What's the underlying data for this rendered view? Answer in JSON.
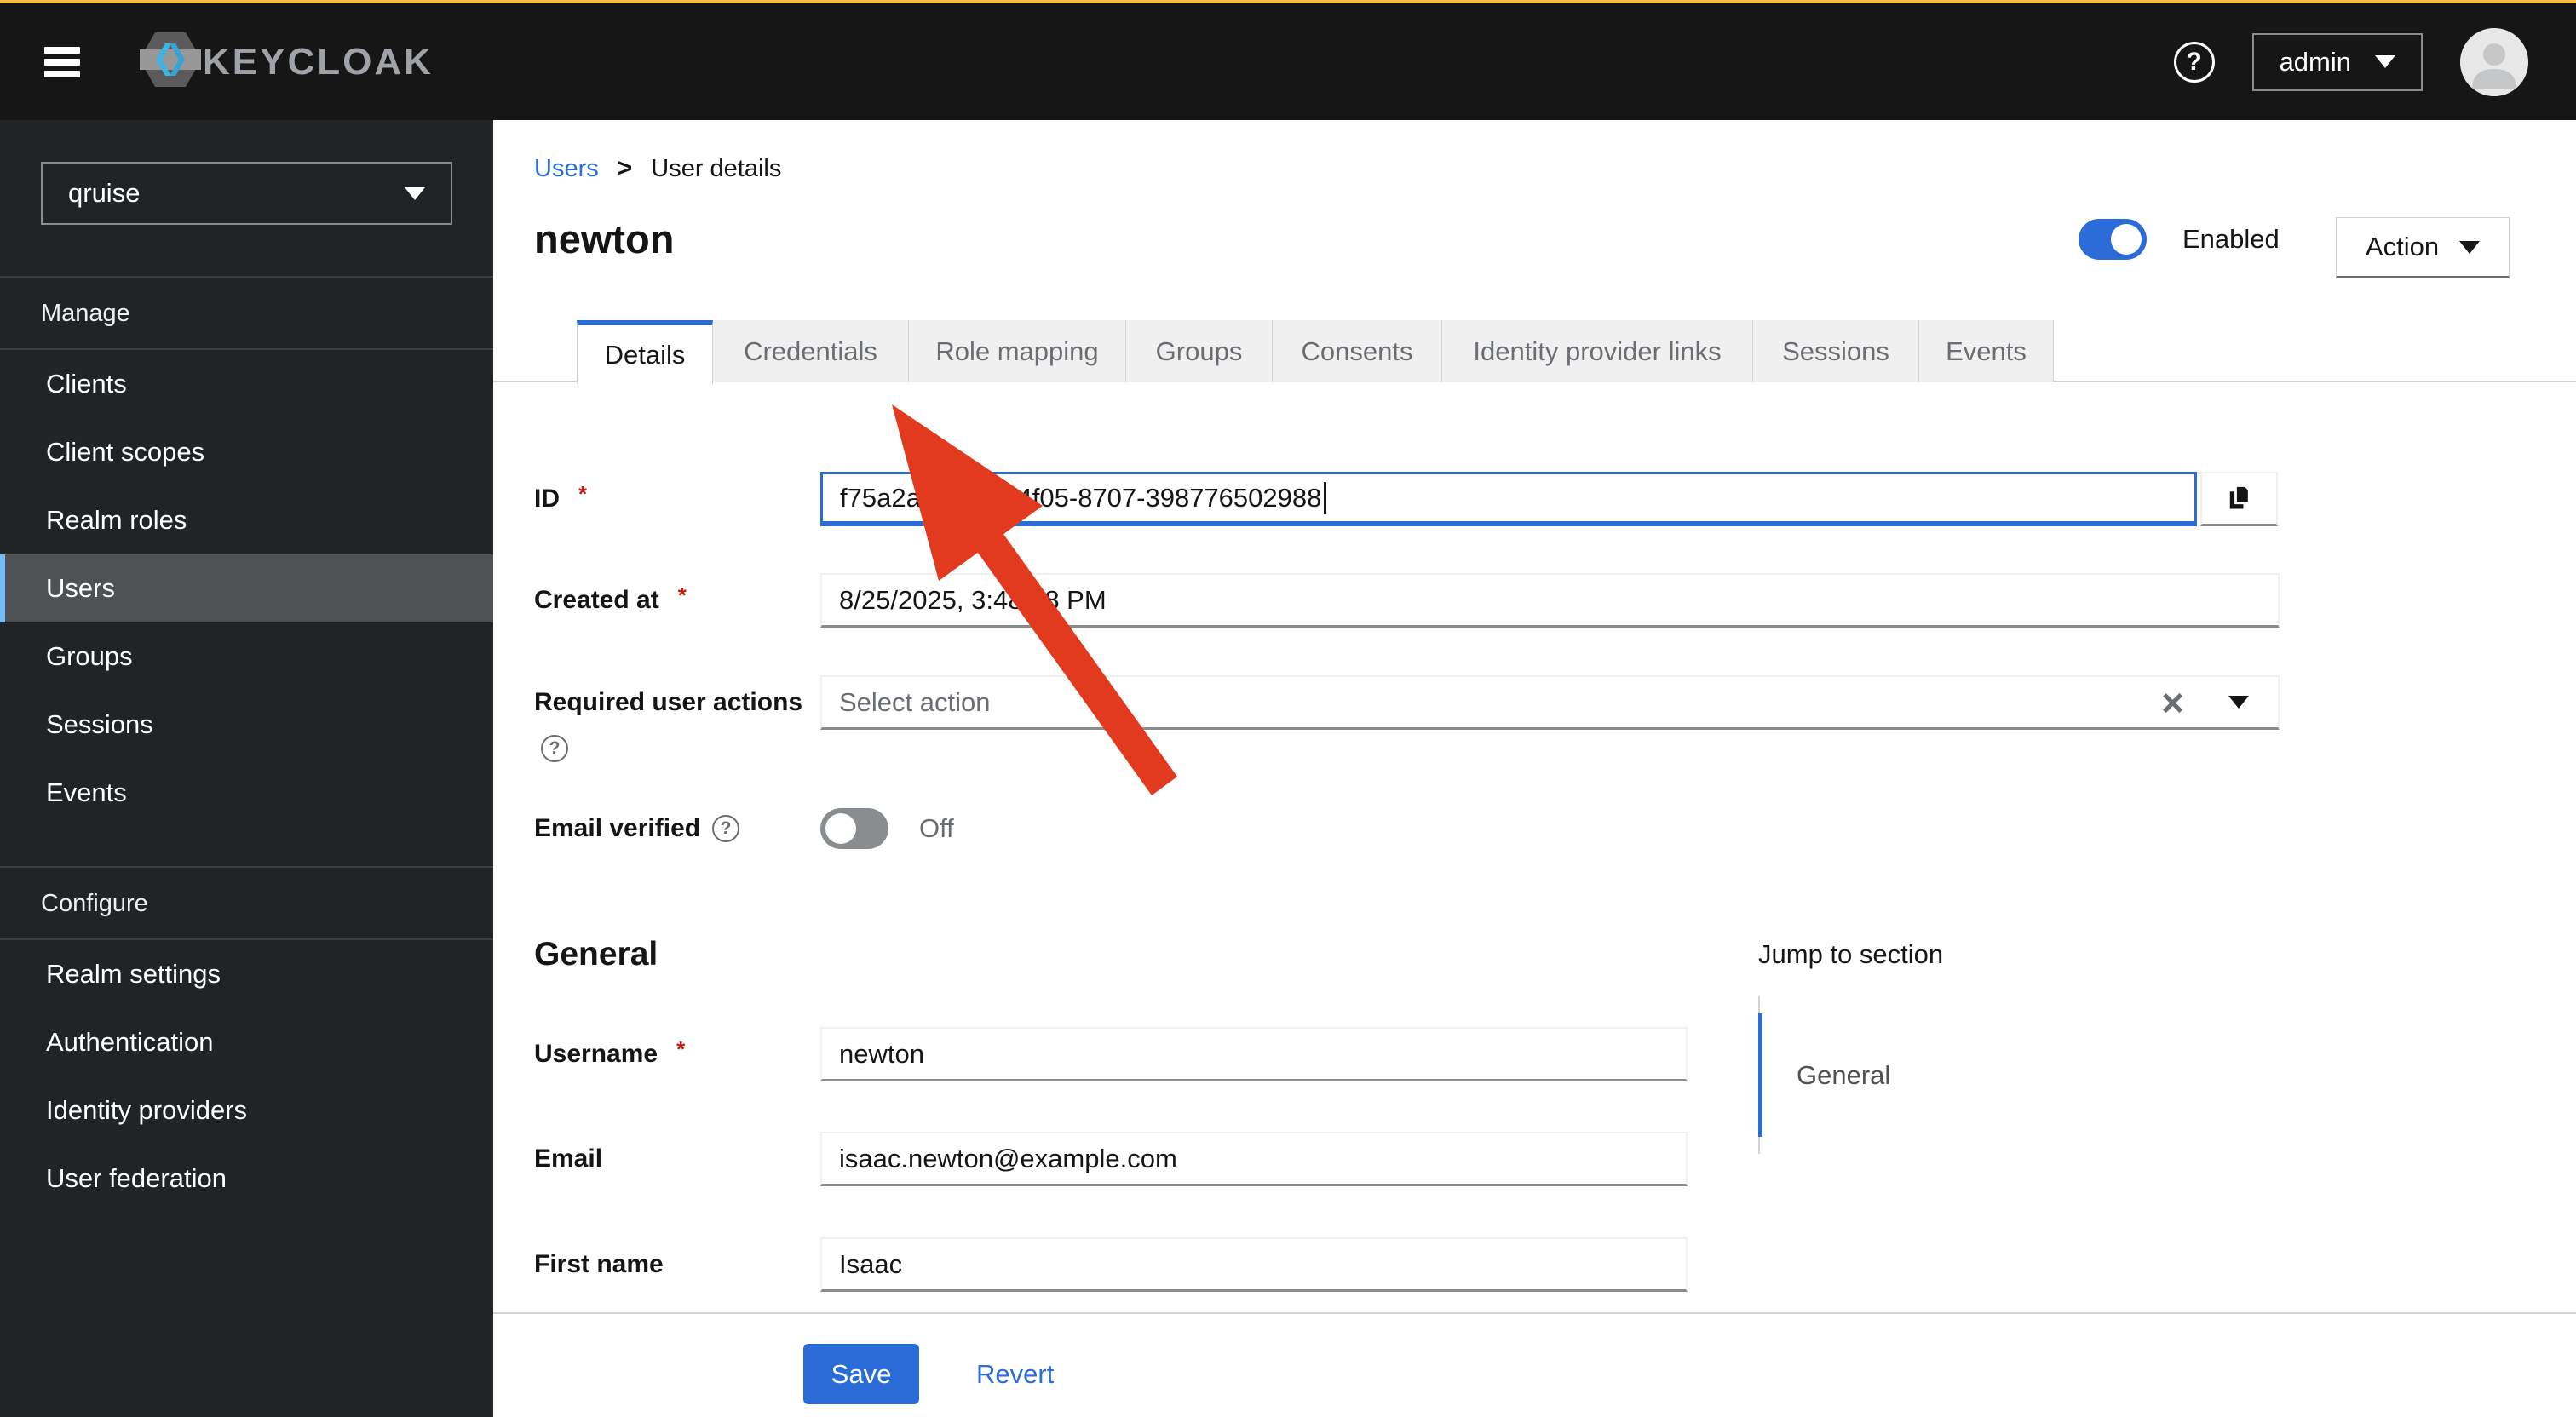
{
  "colors": {
    "accent": "#2b6cd8",
    "masthead_bar": "#f4c145",
    "danger": "#c9190b",
    "arrow": "#e13a1f",
    "sidebar_accent": "#73bcf7"
  },
  "header": {
    "brand": "KEYCLOAK",
    "help_label": "?",
    "user": "admin"
  },
  "sidebar": {
    "realm": "qruise",
    "sections": [
      {
        "label": "Manage",
        "items": [
          "Clients",
          "Client scopes",
          "Realm roles",
          "Users",
          "Groups",
          "Sessions",
          "Events"
        ]
      },
      {
        "label": "Configure",
        "items": [
          "Realm settings",
          "Authentication",
          "Identity providers",
          "User federation"
        ]
      }
    ]
  },
  "breadcrumb": {
    "parent": "Users",
    "separator": ">",
    "current": "User details"
  },
  "user_page": {
    "title": "newton",
    "enabled_label": "Enabled",
    "action_label": "Action"
  },
  "tabs": [
    "Details",
    "Credentials",
    "Role mapping",
    "Groups",
    "Consents",
    "Identity provider links",
    "Sessions",
    "Events"
  ],
  "form": {
    "id_label": "ID",
    "id_value": "f75a2a42-9fc9-4f05-8707-398776502988",
    "created_label": "Created at",
    "created_value": "8/25/2025, 3:48:28 PM",
    "actions_label": "Required user actions",
    "actions_placeholder": "Select action",
    "clear_symbol": "×",
    "email_verified_label": "Email verified",
    "email_verified_state": "Off"
  },
  "general": {
    "heading": "General",
    "username_label": "Username",
    "username_value": "newton",
    "email_label": "Email",
    "email_value": "isaac.newton@example.com",
    "firstname_label": "First name",
    "firstname_value": "Isaac"
  },
  "jump": {
    "heading": "Jump to section",
    "item": "General"
  },
  "footer": {
    "save": "Save",
    "revert": "Revert"
  }
}
